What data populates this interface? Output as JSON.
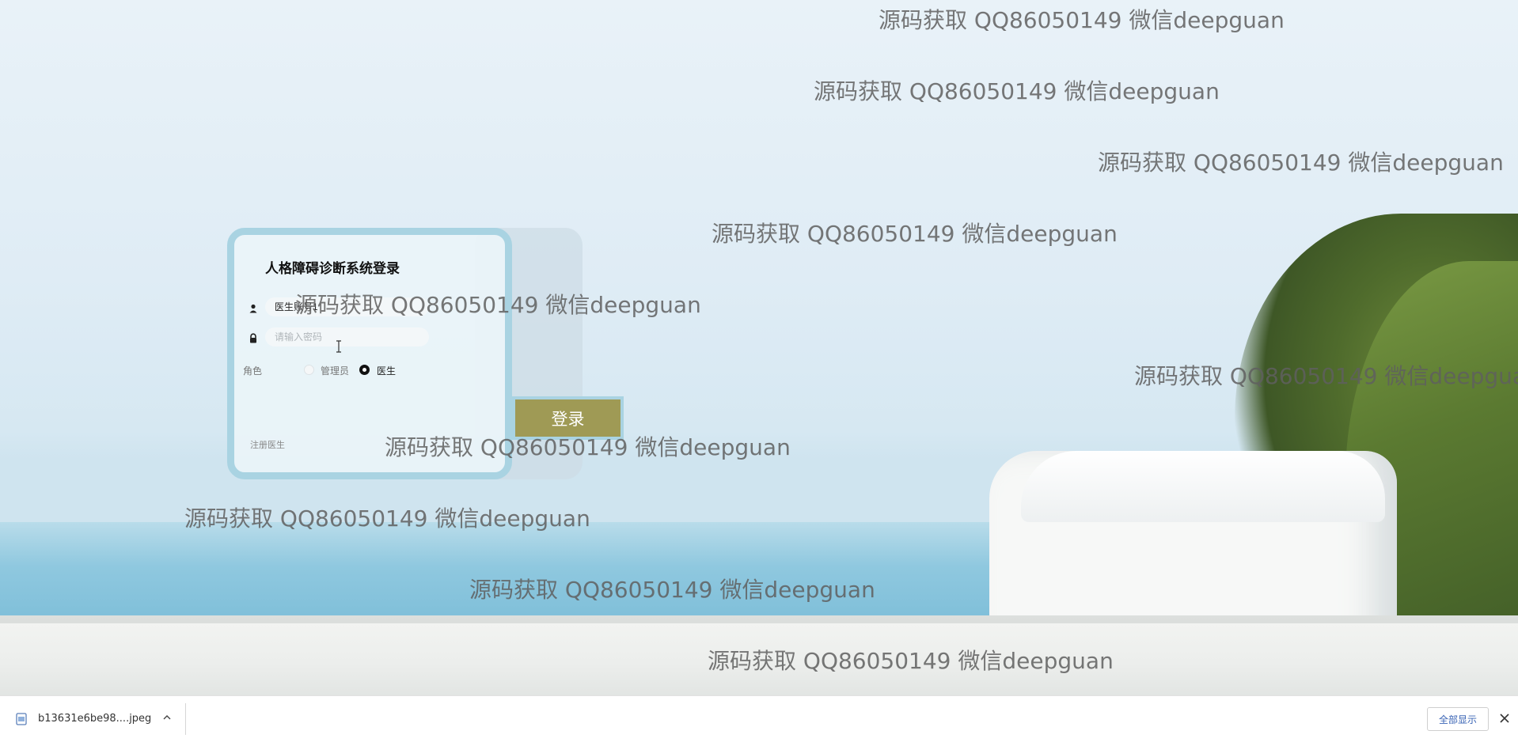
{
  "watermark": "源码获取 QQ86050149 微信deepguan",
  "login": {
    "title": "人格障碍诊断系统登录",
    "username_value": "医生账号1",
    "password_placeholder": "请输入密码",
    "role_label": "角色",
    "role_options": [
      "管理员",
      "医生"
    ],
    "selected_role": "医生",
    "register_link": "注册医生",
    "submit": "登录"
  },
  "colors": {
    "card_border": "#a9d3e2",
    "button_bg": "#9f9a55",
    "show_all_text": "#3a64b5"
  },
  "download_bar": {
    "file_name": "b13631e6be98....jpeg",
    "show_all": "全部显示"
  },
  "icons": [
    "user-icon",
    "lock-icon",
    "file-icon",
    "chevron-up-icon",
    "close-icon",
    "text-cursor-icon"
  ]
}
